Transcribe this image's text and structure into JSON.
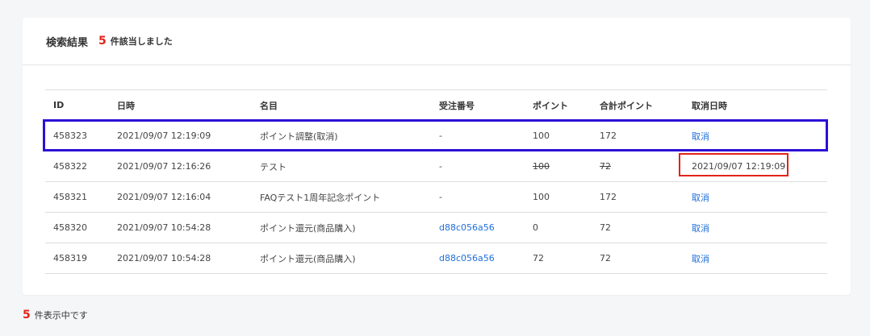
{
  "header": {
    "title": "検索結果",
    "count": "5",
    "suffix": "件該当しました"
  },
  "table": {
    "columns": [
      "ID",
      "日時",
      "名目",
      "受注番号",
      "ポイント",
      "合計ポイント",
      "取消日時"
    ],
    "rows": [
      {
        "id": "458323",
        "date": "2021/09/07 12:19:09",
        "name": "ポイント調整(取消)",
        "order": "-",
        "point": "100",
        "total": "172",
        "cancel": "取消"
      },
      {
        "id": "458322",
        "date": "2021/09/07 12:16:26",
        "name": "テスト",
        "order": "-",
        "point": "100",
        "total": "72",
        "cancel": "2021/09/07 12:19:09"
      },
      {
        "id": "458321",
        "date": "2021/09/07 12:16:04",
        "name": "FAQテスト1周年記念ポイント",
        "order": "-",
        "point": "100",
        "total": "172",
        "cancel": "取消"
      },
      {
        "id": "458320",
        "date": "2021/09/07 10:54:28",
        "name": "ポイント還元(商品購入)",
        "order": "d88c056a56",
        "point": "0",
        "total": "72",
        "cancel": "取消"
      },
      {
        "id": "458319",
        "date": "2021/09/07 10:54:28",
        "name": "ポイント還元(商品購入)",
        "order": "d88c056a56",
        "point": "72",
        "total": "72",
        "cancel": "取消"
      }
    ]
  },
  "footer": {
    "count": "5",
    "text": "件表示中です"
  },
  "colors": {
    "accent_red": "#e2231a",
    "link_blue": "#1e6fd9",
    "highlight_blue": "#2b10d6"
  }
}
